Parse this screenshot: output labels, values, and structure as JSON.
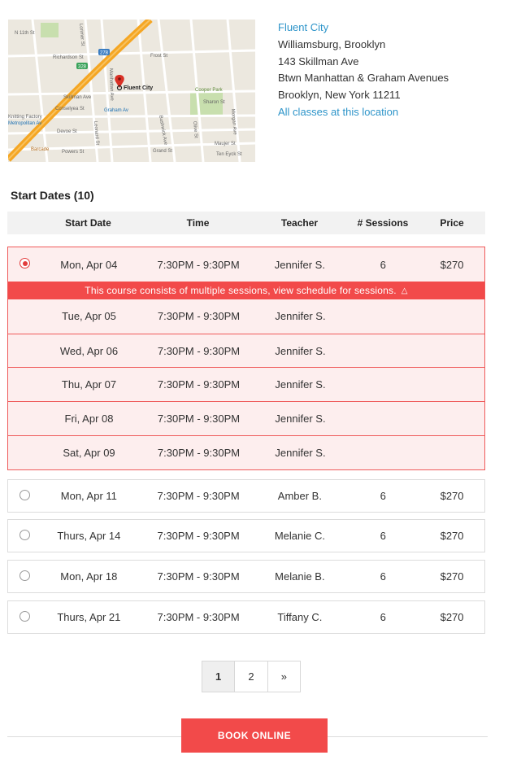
{
  "location": {
    "name": "Fluent City",
    "neighborhood": "Williamsburg, Brooklyn",
    "address": "143 Skillman Ave",
    "cross_streets": "Btwn Manhattan & Graham Avenues",
    "city_state_zip": "Brooklyn, New York 11211",
    "all_classes_link": "All classes at this location"
  },
  "map": {
    "pin_label": "Fluent City",
    "labels": {
      "n11": "N 11th St",
      "richardson": "Richardson St",
      "frost": "Frost St",
      "skillman": "Skillman Ave",
      "conselyea": "Conselyea St",
      "devoe": "Devoe St",
      "powers": "Powers St",
      "grand": "Grand St",
      "graham_av": "Graham Av",
      "metro_av": "Metropolitan Av",
      "barcade": "Barcade",
      "knitting": "Knitting Factory",
      "cooper": "Cooper Park",
      "sharon": "Sharon St",
      "maujer": "Maujer St",
      "tenEyck": "Ten Eyck St",
      "manhattan_ave": "Manhattan Ave",
      "bushwick": "Bushwick Ave",
      "olive": "Olive St",
      "morgan": "Morgan Ave",
      "leonard": "Leonard St",
      "lorimer": "Lorimer St",
      "hwy278": "278",
      "hwy328": "328"
    },
    "colors": {
      "land": "#ece8df",
      "highway": "#f5a623",
      "pin": "#d93025",
      "park": "#c8dfae"
    }
  },
  "start_dates": {
    "title": "Start Dates (10)",
    "headers": {
      "date": "Start Date",
      "time": "Time",
      "teacher": "Teacher",
      "sessions": "# Sessions",
      "price": "Price"
    },
    "selected": {
      "date": "Mon, Apr 04",
      "time": "7:30PM - 9:30PM",
      "teacher": "Jennifer S.",
      "sessions": "6",
      "price": "$270",
      "notice": "This course consists of multiple sessions, view schedule for sessions.",
      "sessions_list": [
        {
          "date": "Tue, Apr 05",
          "time": "7:30PM - 9:30PM",
          "teacher": "Jennifer S."
        },
        {
          "date": "Wed, Apr 06",
          "time": "7:30PM - 9:30PM",
          "teacher": "Jennifer S."
        },
        {
          "date": "Thu, Apr 07",
          "time": "7:30PM - 9:30PM",
          "teacher": "Jennifer S."
        },
        {
          "date": "Fri, Apr 08",
          "time": "7:30PM - 9:30PM",
          "teacher": "Jennifer S."
        },
        {
          "date": "Sat, Apr 09",
          "time": "7:30PM - 9:30PM",
          "teacher": "Jennifer S."
        }
      ]
    },
    "rows": [
      {
        "date": "Mon, Apr 11",
        "time": "7:30PM - 9:30PM",
        "teacher": "Amber B.",
        "sessions": "6",
        "price": "$270"
      },
      {
        "date": "Thurs, Apr 14",
        "time": "7:30PM - 9:30PM",
        "teacher": "Melanie C.",
        "sessions": "6",
        "price": "$270"
      },
      {
        "date": "Mon, Apr 18",
        "time": "7:30PM - 9:30PM",
        "teacher": "Melanie B.",
        "sessions": "6",
        "price": "$270"
      },
      {
        "date": "Thurs, Apr 21",
        "time": "7:30PM - 9:30PM",
        "teacher": "Tiffany C.",
        "sessions": "6",
        "price": "$270"
      }
    ]
  },
  "pagination": {
    "pages": [
      "1",
      "2"
    ],
    "next": "»",
    "current": "1"
  },
  "book_button": "BOOK ONLINE",
  "colors": {
    "accent": "#f24a4a",
    "link": "#2d94c9"
  }
}
